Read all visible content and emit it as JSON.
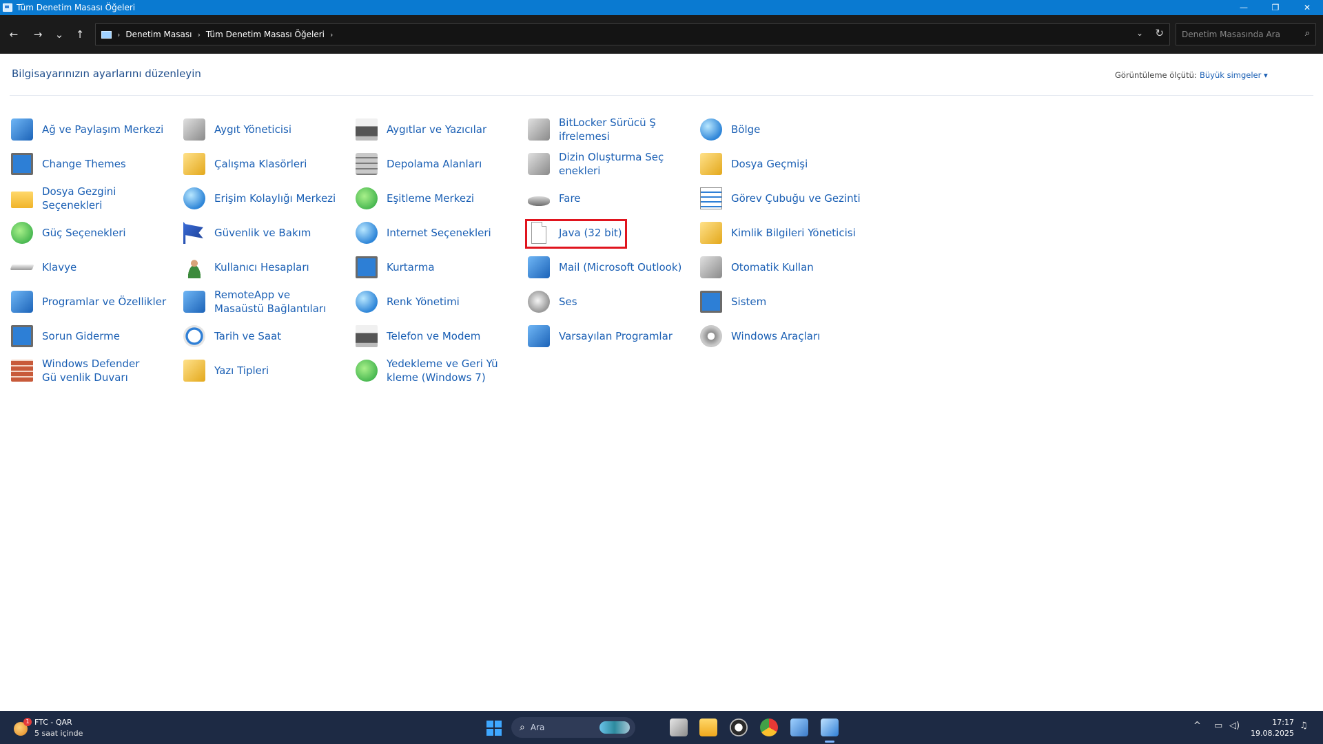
{
  "window": {
    "title": "Tüm Denetim Masası Öğeleri"
  },
  "controls": {
    "minimize": "—",
    "restore": "❐",
    "close": "✕"
  },
  "nav": {
    "back": "←",
    "forward": "→",
    "recent": "⌄",
    "up": "↑"
  },
  "breadcrumb": [
    "Denetim Masası",
    "Tüm Denetim Masası Öğeleri"
  ],
  "search": {
    "placeholder": "Denetim Masasında Ara"
  },
  "header": {
    "title": "Bilgisayarınızın ayarlarını düzenleyin",
    "view_label": "Görüntüleme ölçütü:",
    "view_value": "Büyük simgeler ▾"
  },
  "items": [
    {
      "label": "Ağ ve Paylaşım Merkezi",
      "icon": "network-icon"
    },
    {
      "label": "Aygıt Yöneticisi",
      "icon": "device-manager-icon"
    },
    {
      "label": "Aygıtlar ve Yazıcılar",
      "icon": "printer-icon"
    },
    {
      "label": "BitLocker Sürücü Ş ifrelemesi",
      "icon": "bitlocker-key-icon"
    },
    {
      "label": "Bölge",
      "icon": "region-globe-icon"
    },
    {
      "label": "Change Themes",
      "icon": "themes-icon"
    },
    {
      "label": "Çalışma Klasörleri",
      "icon": "work-folders-icon"
    },
    {
      "label": "Depolama Alanları",
      "icon": "storage-spaces-icon"
    },
    {
      "label": "Dizin Oluşturma Seç enekleri",
      "icon": "indexing-icon"
    },
    {
      "label": "Dosya Geçmişi",
      "icon": "file-history-icon"
    },
    {
      "label": "Dosya Gezgini Seçenekleri",
      "icon": "folder-options-icon"
    },
    {
      "label": "Erişim Kolaylığı Merkezi",
      "icon": "accessibility-icon"
    },
    {
      "label": "Eşitleme Merkezi",
      "icon": "sync-center-icon"
    },
    {
      "label": "Fare",
      "icon": "mouse-icon"
    },
    {
      "label": "Görev Çubuğu ve Gezinti",
      "icon": "taskbar-icon"
    },
    {
      "label": "Güç Seçenekleri",
      "icon": "power-options-icon"
    },
    {
      "label": "Güvenlik ve Bakım",
      "icon": "security-flag-icon"
    },
    {
      "label": "Internet Seçenekleri",
      "icon": "internet-options-icon"
    },
    {
      "label": "Java (32 bit)",
      "icon": "java-page-icon"
    },
    {
      "label": "Kimlik Bilgileri Yöneticisi",
      "icon": "credential-manager-icon"
    },
    {
      "label": "Klavye",
      "icon": "keyboard-icon"
    },
    {
      "label": "Kullanıcı Hesapları",
      "icon": "user-accounts-icon"
    },
    {
      "label": "Kurtarma",
      "icon": "recovery-icon"
    },
    {
      "label": "Mail (Microsoft Outlook)",
      "icon": "mail-icon"
    },
    {
      "label": "Otomatik Kullan",
      "icon": "autoplay-icon"
    },
    {
      "label": "Programlar ve Özellikler",
      "icon": "programs-icon"
    },
    {
      "label": "RemoteApp ve Masaüstü Bağlantıları",
      "icon": "remoteapp-icon"
    },
    {
      "label": "Renk Yönetimi",
      "icon": "color-management-icon"
    },
    {
      "label": "Ses",
      "icon": "sound-icon"
    },
    {
      "label": "Sistem",
      "icon": "system-icon"
    },
    {
      "label": "Sorun Giderme",
      "icon": "troubleshooting-icon"
    },
    {
      "label": "Tarih ve Saat",
      "icon": "date-time-icon"
    },
    {
      "label": "Telefon ve Modem",
      "icon": "phone-modem-icon"
    },
    {
      "label": "Varsayılan Programlar",
      "icon": "default-programs-icon"
    },
    {
      "label": "Windows Araçları",
      "icon": "windows-tools-icon"
    },
    {
      "label": "Windows Defender Gü venlik Duvarı",
      "icon": "firewall-icon"
    },
    {
      "label": "Yazı Tipleri",
      "icon": "fonts-icon"
    },
    {
      "label": "Yedekleme ve Geri Yü kleme (Windows 7)",
      "icon": "backup-restore-icon"
    }
  ],
  "taskbar": {
    "weather_title": "FTC - QAR",
    "weather_sub": "5 saat içinde",
    "weather_badge": "1",
    "search_label": "Ara",
    "search_glyph": "⌕",
    "time": "17:17",
    "date": "19.08.2025",
    "tray_chevron": "^",
    "tray_network": "▭",
    "tray_volume": "◁)",
    "tray_bell": "♫"
  },
  "colors": {
    "accent": "#0a7ad1",
    "link": "#1a5fb4",
    "highlight": "#e0141e",
    "taskbar": "#1d2a44"
  }
}
